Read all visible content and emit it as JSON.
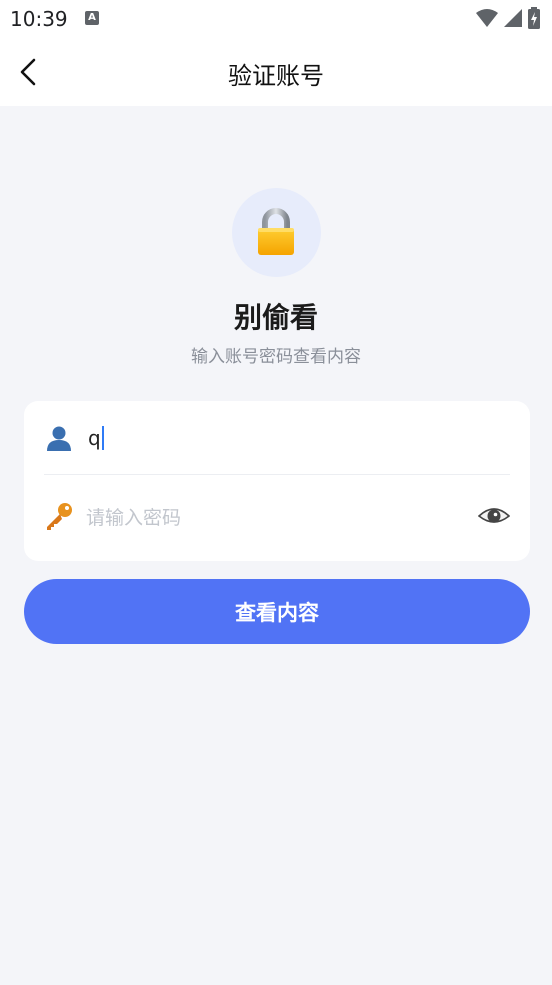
{
  "status_bar": {
    "time": "10:39",
    "notification_badge": "A"
  },
  "header": {
    "title": "验证账号",
    "back_icon": "chevron-left-icon"
  },
  "hero": {
    "icon": "lock-icon",
    "title": "别偷看",
    "subtitle": "输入账号密码查看内容"
  },
  "form": {
    "account": {
      "icon": "user-icon",
      "value": "q"
    },
    "password": {
      "icon": "key-icon",
      "placeholder": "请输入密码",
      "toggle_icon": "eye-icon"
    }
  },
  "submit": {
    "label": "查看内容"
  },
  "colors": {
    "primary": "#5173f5",
    "background": "#f4f5f9",
    "caret": "#2f7bf6"
  }
}
